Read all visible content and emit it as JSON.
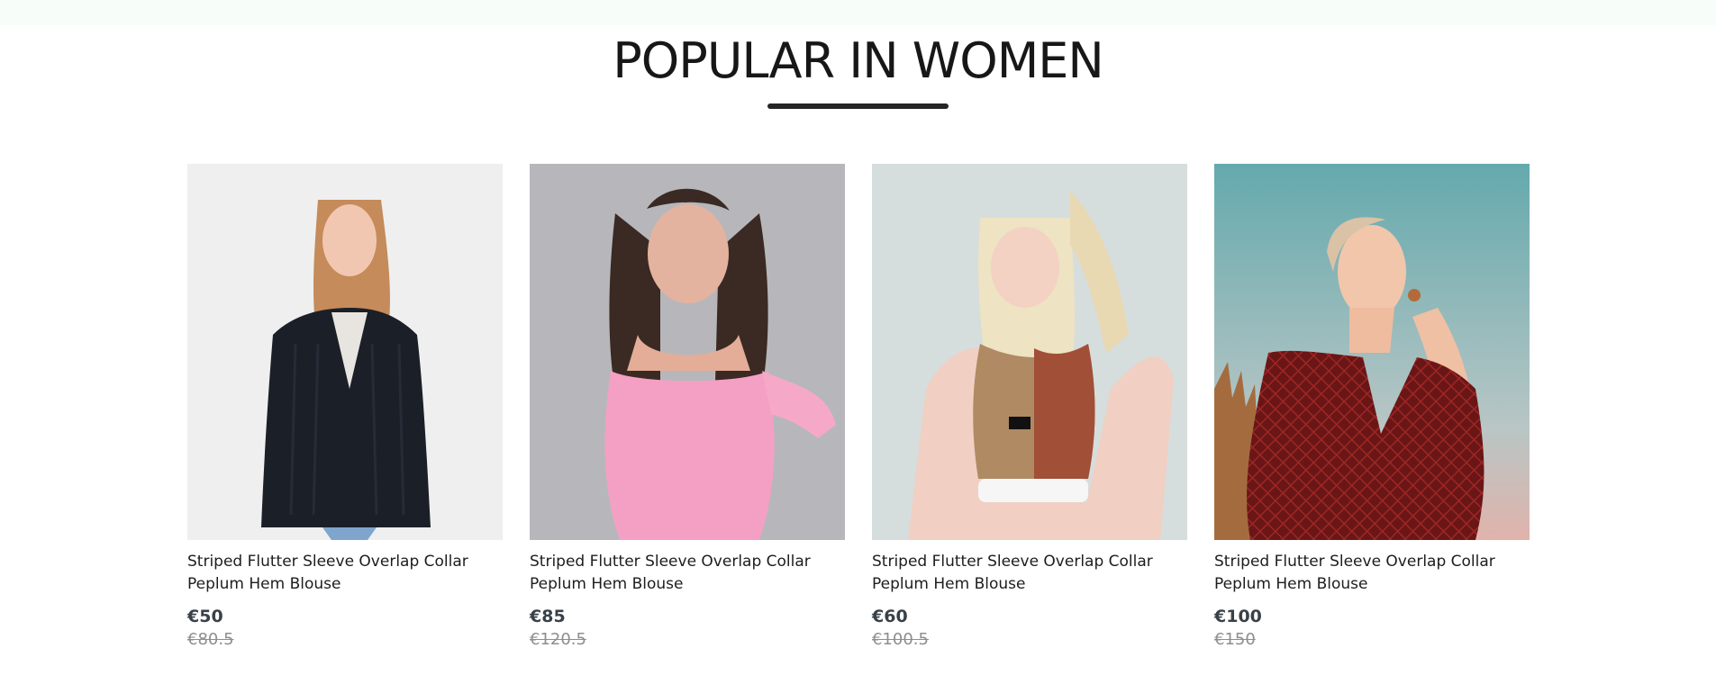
{
  "section": {
    "title": "POPULAR IN WOMEN"
  },
  "products": [
    {
      "name": "Striped Flutter Sleeve Overlap Collar Peplum Hem Blouse",
      "new_price": "€50",
      "old_price": "€80.5",
      "image_bg": "#efefef",
      "garment_color": "#1a1d25"
    },
    {
      "name": "Striped Flutter Sleeve Overlap Collar Peplum Hem Blouse",
      "new_price": "€85",
      "old_price": "€120.5",
      "image_bg": "#b7b7bb",
      "garment_color": "#f4a0c4"
    },
    {
      "name": "Striped Flutter Sleeve Overlap Collar Peplum Hem Blouse",
      "new_price": "€60",
      "old_price": "€100.5",
      "image_bg": "#d6dddd",
      "garment_color": "#b08a63"
    },
    {
      "name": "Striped Flutter Sleeve Overlap Collar Peplum Hem Blouse",
      "new_price": "€100",
      "old_price": "€150",
      "image_bg": "#6aa8ad",
      "garment_color": "#6a1616"
    }
  ]
}
